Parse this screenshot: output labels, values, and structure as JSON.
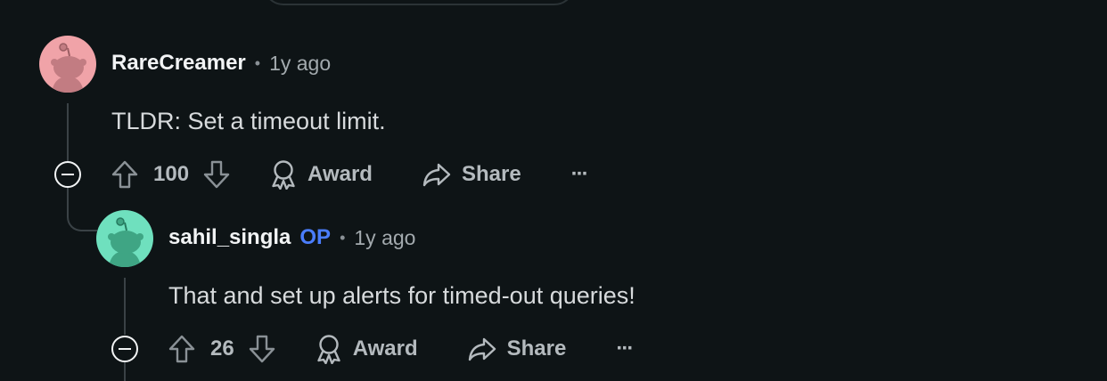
{
  "comments": [
    {
      "author": "RareCreamer",
      "separator": "•",
      "time": "1y ago",
      "text": "TLDR: Set a timeout limit.",
      "score": "100",
      "award_label": "Award",
      "share_label": "Share",
      "more_label": "···",
      "avatar_color": "#f0a3a8"
    },
    {
      "author": "sahil_singla",
      "op_badge": "OP",
      "separator": "•",
      "time": "1y ago",
      "text": "That and set up alerts for timed-out queries!",
      "score": "26",
      "award_label": "Award",
      "share_label": "Share",
      "more_label": "···",
      "avatar_color": "#6fe0be"
    }
  ],
  "colors": {
    "background": "#0e1416",
    "op_badge": "#4a7dfc",
    "thread_line": "#3a4246"
  },
  "icons": [
    "upvote-icon",
    "downvote-icon",
    "award-icon",
    "share-icon",
    "more-icon",
    "collapse-icon",
    "snoo-avatar-icon"
  ]
}
